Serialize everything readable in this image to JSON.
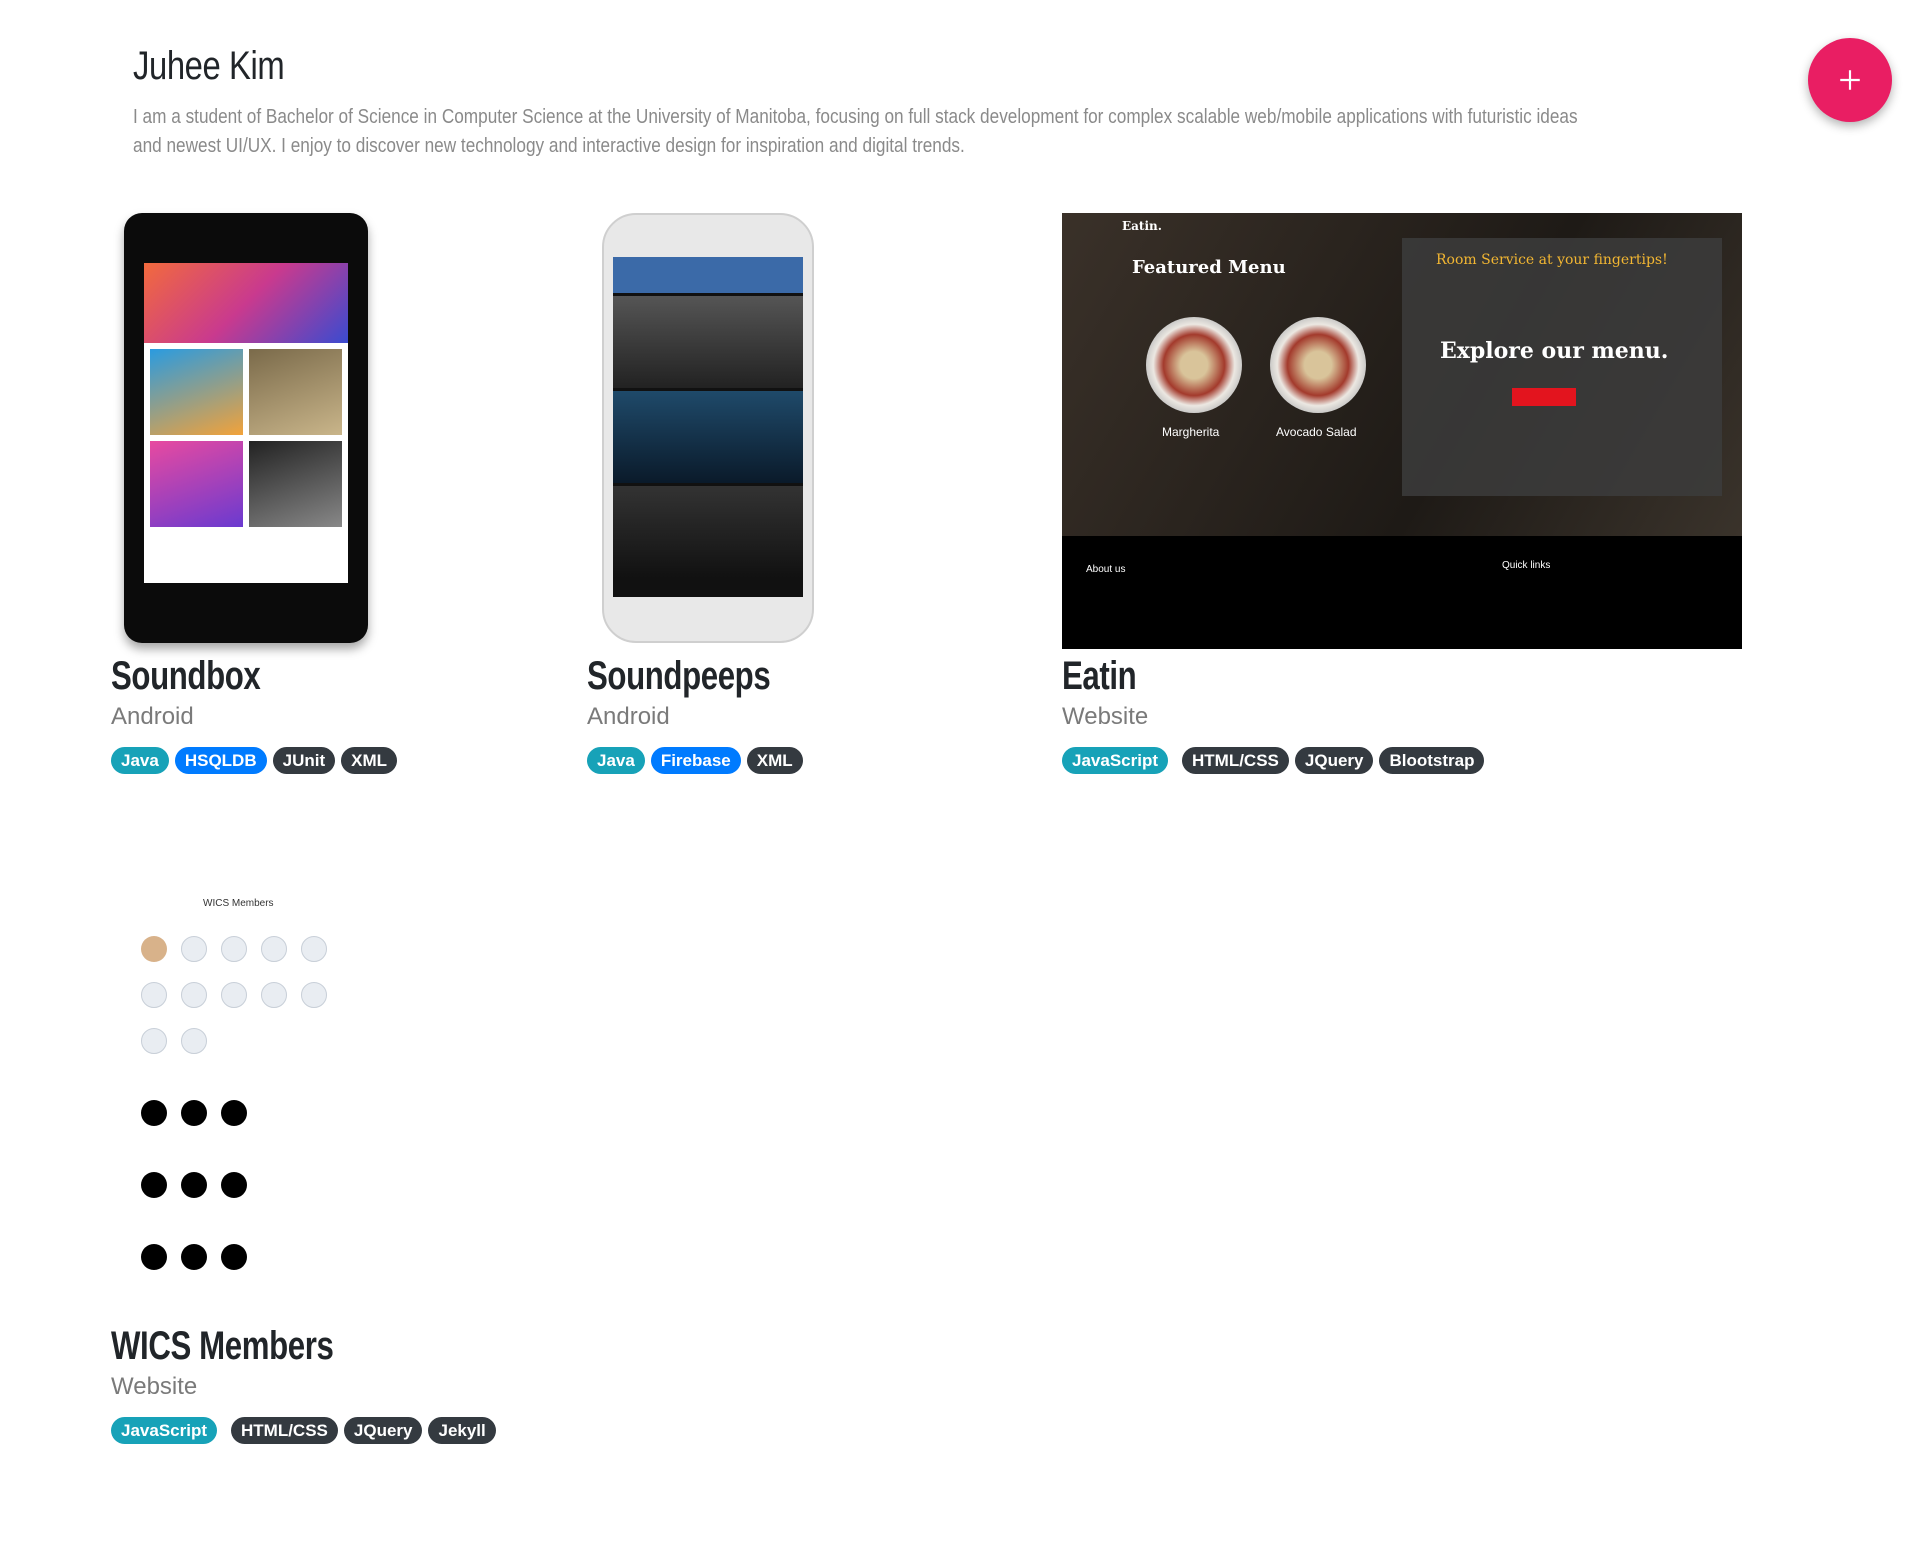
{
  "header": {
    "name": "Juhee Kim",
    "bio": "I am a student of Bachelor of Science in Computer Science at the University of Manitoba, focusing on full stack development for complex scalable web/mobile applications with futuristic ideas and newest UI/UX. I enjoy to discover new technology and interactive design for inspiration and digital trends."
  },
  "fab": {
    "icon": "plus-icon"
  },
  "projects": [
    {
      "title": "Soundbox",
      "type": "Android",
      "tags": [
        "Java",
        "HSQLDB",
        "JUnit",
        "XML"
      ]
    },
    {
      "title": "Soundpeeps",
      "type": "Android",
      "tags": [
        "Java",
        "Firebase",
        "XML"
      ]
    },
    {
      "title": "Eatin",
      "type": "Website",
      "tags": [
        "JavaScript",
        "HTML/CSS",
        "JQuery",
        "Blootstrap"
      ]
    },
    {
      "title": "WICS Members",
      "type": "Website",
      "tags": [
        "JavaScript",
        "HTML/CSS",
        "JQuery",
        "Jekyll"
      ]
    }
  ],
  "thumbs": {
    "eatin": {
      "brand": "Eatin.",
      "featured": "Featured Menu",
      "room": "Room Service at your fingertips!",
      "explore": "Explore our menu.",
      "item1": "Margherita",
      "item2": "Avocado Salad",
      "about": "About us",
      "quick": "Quick links"
    },
    "wics": {
      "title": "WICS Members"
    }
  },
  "colors": {
    "fab": "#e91e63",
    "teal": "#17a2b8",
    "blue": "#007bff",
    "dark": "#343a40"
  }
}
